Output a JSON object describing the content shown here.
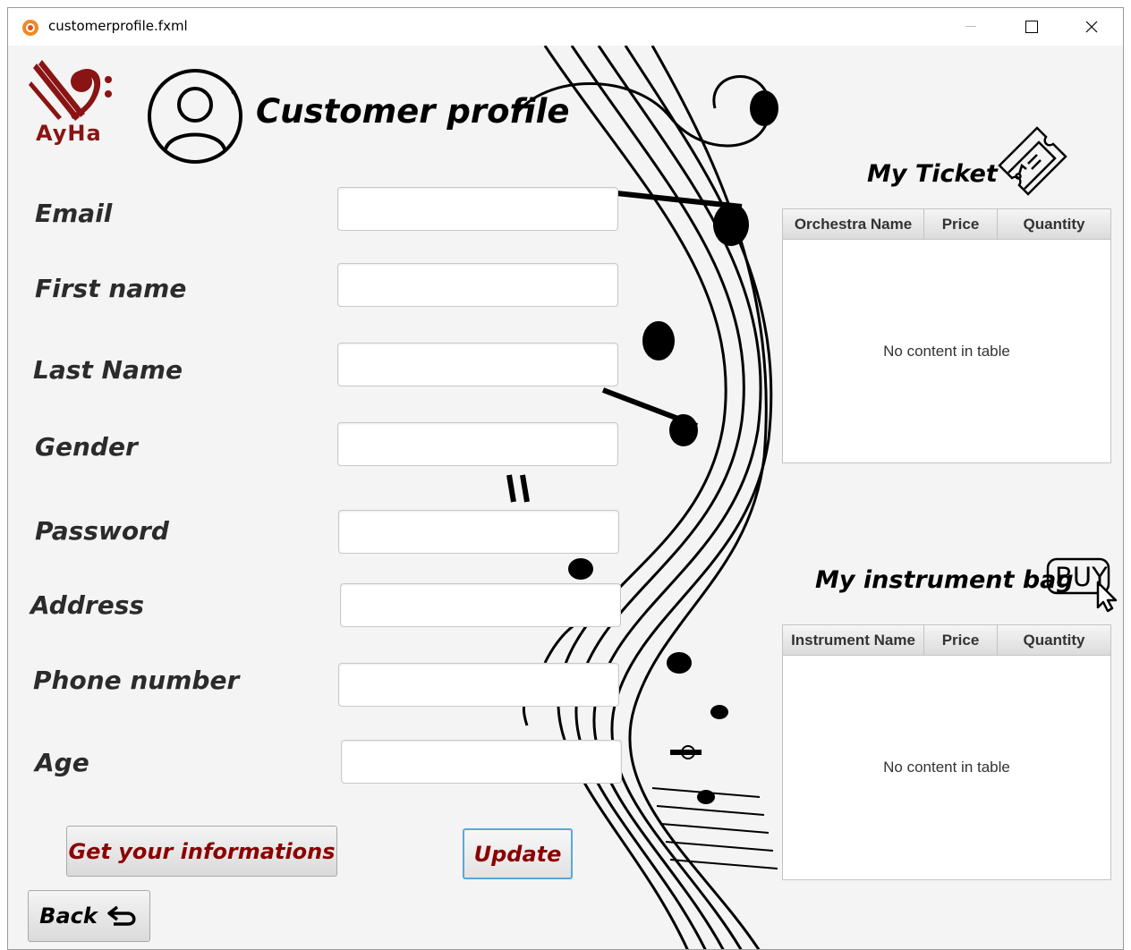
{
  "window": {
    "title": "customerprofile.fxml"
  },
  "header": {
    "logo_text": "AyHa",
    "page_title": "Customer profile"
  },
  "form": {
    "fields": [
      {
        "label": "Email",
        "value": ""
      },
      {
        "label": "First name",
        "value": ""
      },
      {
        "label": "Last Name",
        "value": ""
      },
      {
        "label": "Gender",
        "value": ""
      },
      {
        "label": "Password",
        "value": ""
      },
      {
        "label": "Address",
        "value": ""
      },
      {
        "label": "Phone number",
        "value": ""
      },
      {
        "label": "Age",
        "value": ""
      }
    ]
  },
  "buttons": {
    "get_info": "Get your informations",
    "update": "Update",
    "back": "Back"
  },
  "ticket": {
    "title": "My Ticket",
    "columns": [
      "Orchestra Name",
      "Price",
      "Quantity"
    ],
    "empty_message": "No content in table"
  },
  "bag": {
    "title": "My instrument bag",
    "buy_label": "BUY",
    "columns": [
      "Instrument Name",
      "Price",
      "Quantity"
    ],
    "empty_message": "No content in table"
  },
  "colors": {
    "accent": "#8b0000",
    "logo": "#8a1414",
    "update_border": "#5aa8d8"
  }
}
